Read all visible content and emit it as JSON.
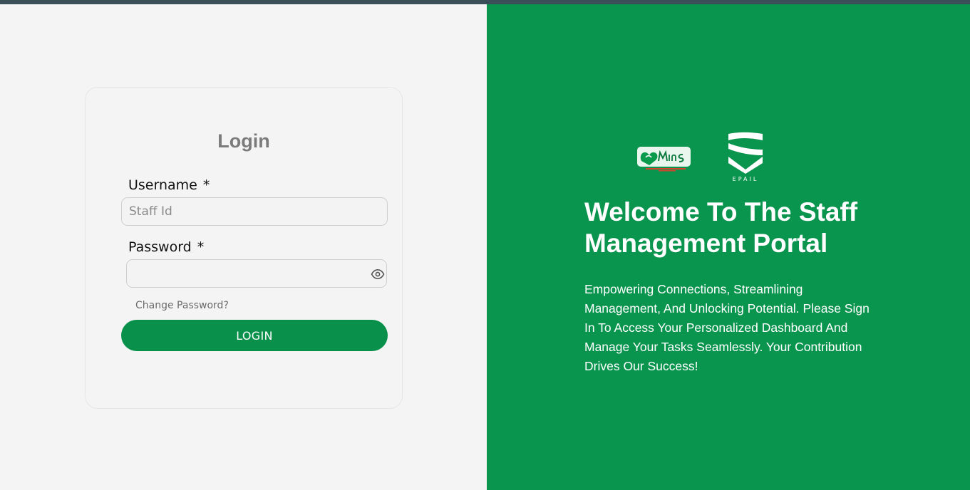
{
  "login": {
    "title": "Login",
    "username_label": "Username",
    "password_label": "Password",
    "required_marker": "*",
    "username_placeholder": "Staff Id",
    "username_value": "",
    "password_value": "",
    "change_password": "Change Password?",
    "login_button": "LOGIN"
  },
  "hero": {
    "logo_left_text": "MinaS",
    "logo_right_text": "EPAIL",
    "title": "Welcome To The Staff Management Portal",
    "description": "Empowering Connections, Streamlining Management, And Unlocking Potential. Please Sign In To Access Your Personalized Dashboard And Manage Your Tasks Seamlessly. Your Contribution Drives Our Success!"
  },
  "colors": {
    "brand_green": "#09954e",
    "button_green": "#09914c",
    "topbar": "#3b4f58",
    "panel_bg": "#f4f4f4"
  },
  "icons": {
    "password_toggle": "eye-icon"
  }
}
